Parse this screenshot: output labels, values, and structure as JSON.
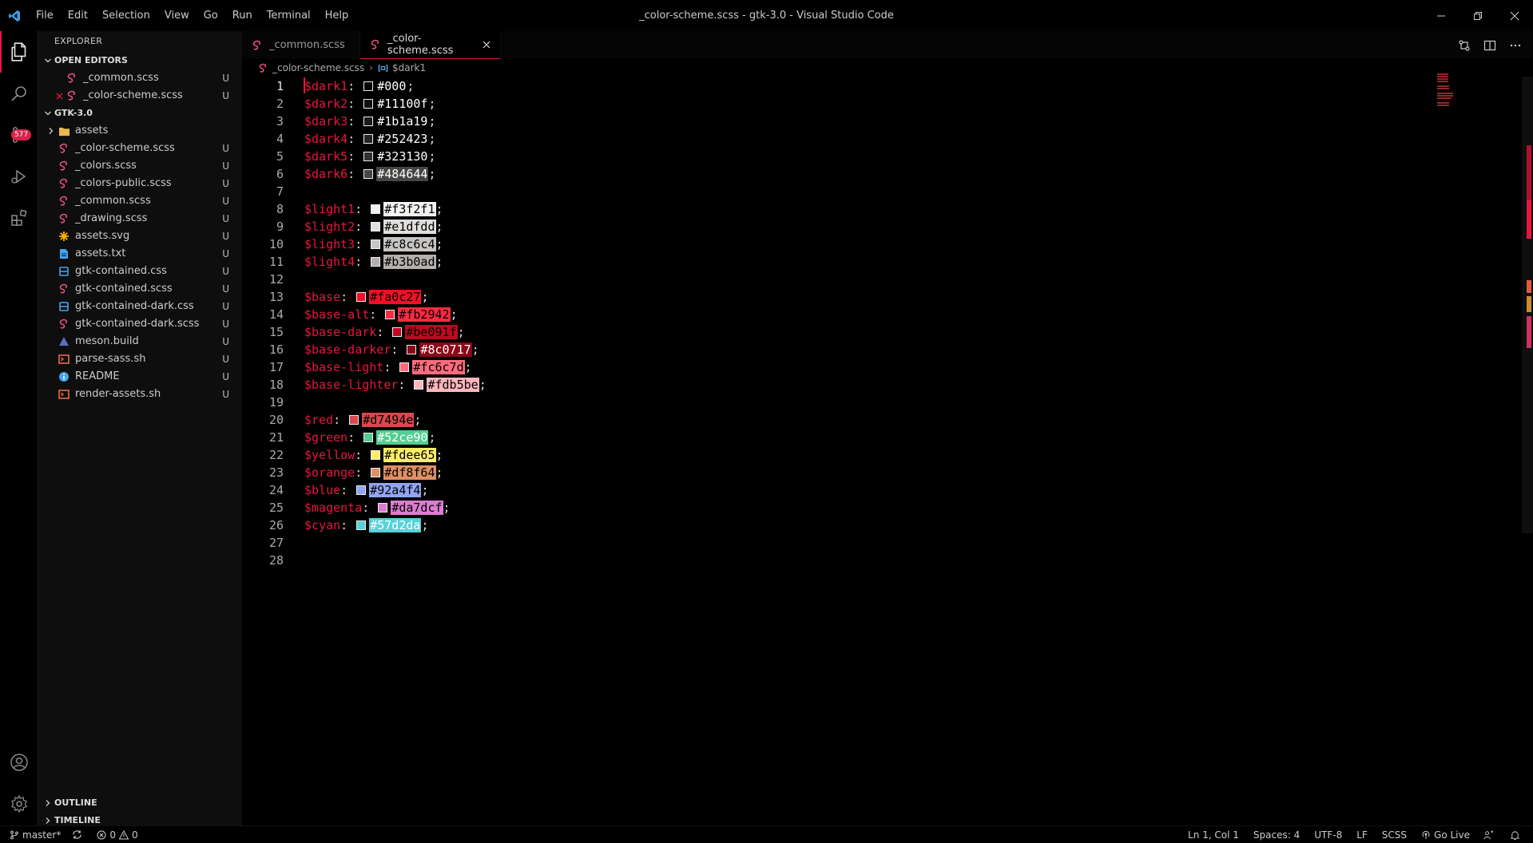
{
  "window": {
    "title": "_color-scheme.scss - gtk-3.0 - Visual Studio Code",
    "menu": [
      "File",
      "Edit",
      "Selection",
      "View",
      "Go",
      "Run",
      "Terminal",
      "Help"
    ]
  },
  "activity_bar": {
    "scm_badge": "577",
    "items": [
      "explorer-icon",
      "search-icon",
      "source-control-icon",
      "run-debug-icon",
      "extensions-icon"
    ],
    "bottom": [
      "account-icon",
      "manage-gear-icon"
    ]
  },
  "sidebar": {
    "title": "EXPLORER",
    "open_editors": {
      "label": "OPEN EDITORS",
      "items": [
        {
          "name": "_common.scss",
          "status": "U"
        },
        {
          "name": "_color-scheme.scss",
          "status": "U"
        }
      ]
    },
    "workspace": {
      "label": "GTK-3.0",
      "items": [
        {
          "name": "assets",
          "status": "",
          "kind": "folder"
        },
        {
          "name": "_color-scheme.scss",
          "status": "U",
          "kind": "scss"
        },
        {
          "name": "_colors.scss",
          "status": "U",
          "kind": "scss"
        },
        {
          "name": "_colors-public.scss",
          "status": "U",
          "kind": "scss"
        },
        {
          "name": "_common.scss",
          "status": "U",
          "kind": "scss"
        },
        {
          "name": "_drawing.scss",
          "status": "U",
          "kind": "scss"
        },
        {
          "name": "assets.svg",
          "status": "U",
          "kind": "svg"
        },
        {
          "name": "assets.txt",
          "status": "U",
          "kind": "txt"
        },
        {
          "name": "gtk-contained.css",
          "status": "U",
          "kind": "css"
        },
        {
          "name": "gtk-contained.scss",
          "status": "U",
          "kind": "scss"
        },
        {
          "name": "gtk-contained-dark.css",
          "status": "U",
          "kind": "css"
        },
        {
          "name": "gtk-contained-dark.scss",
          "status": "U",
          "kind": "scss"
        },
        {
          "name": "meson.build",
          "status": "U",
          "kind": "meson"
        },
        {
          "name": "parse-sass.sh",
          "status": "U",
          "kind": "sh"
        },
        {
          "name": "README",
          "status": "U",
          "kind": "info"
        },
        {
          "name": "render-assets.sh",
          "status": "U",
          "kind": "sh"
        }
      ]
    },
    "outline_label": "OUTLINE",
    "timeline_label": "TIMELINE"
  },
  "tabs": [
    {
      "label": "_common.scss",
      "active": false
    },
    {
      "label": "_color-scheme.scss",
      "active": true
    }
  ],
  "breadcrumb": {
    "file": "_color-scheme.scss",
    "symbol": "$dark1"
  },
  "code_lines": [
    {
      "n": "1",
      "var": "$dark1",
      "swatch": "#000000",
      "value": "#000",
      "bg": "",
      "fg": "#ffffff"
    },
    {
      "n": "2",
      "var": "$dark2",
      "swatch": "#11100f",
      "value": "#11100f",
      "bg": "",
      "fg": "#ffffff"
    },
    {
      "n": "3",
      "var": "$dark3",
      "swatch": "#1b1a19",
      "value": "#1b1a19",
      "bg": "",
      "fg": "#ffffff"
    },
    {
      "n": "4",
      "var": "$dark4",
      "swatch": "#252423",
      "value": "#252423",
      "bg": "",
      "fg": "#ffffff"
    },
    {
      "n": "5",
      "var": "$dark5",
      "swatch": "#323130",
      "value": "#323130",
      "bg": "",
      "fg": "#ffffff"
    },
    {
      "n": "6",
      "var": "$dark6",
      "swatch": "#484644",
      "value": "#484644",
      "bg": "#484644",
      "fg": "#ffffff"
    },
    {
      "n": "7"
    },
    {
      "n": "8",
      "var": "$light1",
      "swatch": "#f3f2f1",
      "value": "#f3f2f1",
      "bg": "#f3f2f1",
      "fg": "#000000"
    },
    {
      "n": "9",
      "var": "$light2",
      "swatch": "#e1dfdd",
      "value": "#e1dfdd",
      "bg": "#e1dfdd",
      "fg": "#000000"
    },
    {
      "n": "10",
      "var": "$light3",
      "swatch": "#c8c6c4",
      "value": "#c8c6c4",
      "bg": "#c8c6c4",
      "fg": "#000000"
    },
    {
      "n": "11",
      "var": "$light4",
      "swatch": "#b3b0ad",
      "value": "#b3b0ad",
      "bg": "#b3b0ad",
      "fg": "#000000"
    },
    {
      "n": "12"
    },
    {
      "n": "13",
      "var": "$base",
      "swatch": "#fa0c27",
      "value": "#fa0c27",
      "bg": "#fa0c27",
      "fg": "#000000"
    },
    {
      "n": "14",
      "var": "$base-alt",
      "swatch": "#fb2942",
      "value": "#fb2942",
      "bg": "#fb2942",
      "fg": "#000000"
    },
    {
      "n": "15",
      "var": "$base-dark",
      "swatch": "#be091f",
      "value": "#be091f",
      "bg": "#be091f",
      "fg": "#000000"
    },
    {
      "n": "16",
      "var": "$base-darker",
      "swatch": "#8c0717",
      "value": "#8c0717",
      "bg": "#8c0717",
      "fg": "#ffffff"
    },
    {
      "n": "17",
      "var": "$base-light",
      "swatch": "#fc6c7d",
      "value": "#fc6c7d",
      "bg": "#fc6c7d",
      "fg": "#000000"
    },
    {
      "n": "18",
      "var": "$base-lighter",
      "swatch": "#fdb5be",
      "value": "#fdb5be",
      "bg": "#fdb5be",
      "fg": "#000000"
    },
    {
      "n": "19"
    },
    {
      "n": "20",
      "var": "$red",
      "swatch": "#d7494e",
      "value": "#d7494e",
      "bg": "#d7494e",
      "fg": "#000000"
    },
    {
      "n": "21",
      "var": "$green",
      "swatch": "#52ce90",
      "value": "#52ce90",
      "bg": "#52ce90",
      "fg": "#ffffff"
    },
    {
      "n": "22",
      "var": "$yellow",
      "swatch": "#fdee65",
      "value": "#fdee65",
      "bg": "#fdee65",
      "fg": "#000000"
    },
    {
      "n": "23",
      "var": "$orange",
      "swatch": "#df8f64",
      "value": "#df8f64",
      "bg": "#df8f64",
      "fg": "#000000"
    },
    {
      "n": "24",
      "var": "$blue",
      "swatch": "#92a4f4",
      "value": "#92a4f4",
      "bg": "#92a4f4",
      "fg": "#000000"
    },
    {
      "n": "25",
      "var": "$magenta",
      "swatch": "#da7dcf",
      "value": "#da7dcf",
      "bg": "#da7dcf",
      "fg": "#000000"
    },
    {
      "n": "26",
      "var": "$cyan",
      "swatch": "#57d2da",
      "value": "#57d2da",
      "bg": "#57d2da",
      "fg": "#ffffff"
    },
    {
      "n": "27"
    },
    {
      "n": "28"
    }
  ],
  "statusbar": {
    "branch": "master*",
    "errors": "0",
    "warnings": "0",
    "position": "Ln 1, Col 1",
    "spaces": "Spaces: 4",
    "encoding": "UTF-8",
    "eol": "LF",
    "language": "SCSS",
    "golive": "Go Live"
  },
  "colors": {
    "accent": "#e8163e",
    "scss_icon": "#f55385",
    "folder": "#e8b84a",
    "css_icon": "#42a5f5"
  }
}
